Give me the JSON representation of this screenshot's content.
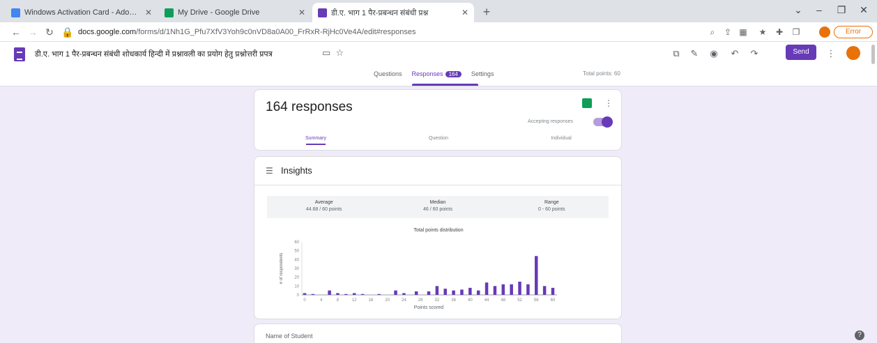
{
  "browser": {
    "tabs": [
      {
        "title": "Windows Activation Card - Adoption",
        "fav_color": "#4285f4"
      },
      {
        "title": "My Drive - Google Drive",
        "fav_color": "#0f9d58"
      },
      {
        "title": "डी.ए. भाग 1 पैर-प्रबन्धन संबंधी प्रश्न",
        "fav_color": "#673ab7"
      }
    ],
    "new_tab": "+",
    "url_host": "docs.google.com",
    "url_path": "/forms/d/1Nh1G_Pfu7XfV3Yoh9c0nVD8a0A00_FrRxR-RjHc0Ve4A/edit#responses",
    "extension_pill": "Error"
  },
  "form": {
    "title": "डी.ए. भाग 1 पैर-प्रबन्धन संबंधी शोधकार्य हिन्दी में प्रश्नावली का प्रयोग हेतु प्रश्नोत्तरी प्रपत्र",
    "send_label": "Send",
    "tabs": {
      "questions": "Questions",
      "responses": "Responses",
      "settings": "Settings",
      "count": "164"
    },
    "total_points": "Total points: 60"
  },
  "responses": {
    "count_text": "164 responses",
    "accepting_label": "Accepting responses",
    "subtabs": [
      "Summary",
      "Question",
      "Individual"
    ]
  },
  "insights": {
    "title": "Insights",
    "stats": [
      {
        "label": "Average",
        "value": "44.68 / 60 points"
      },
      {
        "label": "Median",
        "value": "46 / 60 points"
      },
      {
        "label": "Range",
        "value": "0 - 60 points"
      }
    ]
  },
  "chart_data": {
    "type": "bar",
    "title": "Total points distribution",
    "xlabel": "Points scored",
    "ylabel": "# of respondents",
    "x_ticks": [
      "0",
      "4",
      "8",
      "12",
      "16",
      "20",
      "24",
      "28",
      "32",
      "36",
      "40",
      "44",
      "48",
      "52",
      "56",
      "60"
    ],
    "y_ticks": [
      "0",
      "10",
      "20",
      "30",
      "40",
      "50",
      "60"
    ],
    "ylim": [
      0,
      60
    ],
    "categories": [
      "0",
      "2",
      "6",
      "8",
      "10",
      "12",
      "14",
      "18",
      "22",
      "24",
      "27",
      "30",
      "32",
      "34",
      "36",
      "38",
      "40",
      "42",
      "44",
      "46",
      "48",
      "50",
      "52",
      "54",
      "56",
      "58",
      "60"
    ],
    "values": [
      2,
      1,
      5,
      2,
      1,
      2,
      1,
      1,
      5,
      2,
      4,
      4,
      10,
      7,
      5,
      6,
      8,
      5,
      14,
      10,
      12,
      12,
      15,
      12,
      44,
      10,
      8
    ],
    "bar_color": "#673ab7"
  },
  "name_card": {
    "label": "Name of Student"
  }
}
